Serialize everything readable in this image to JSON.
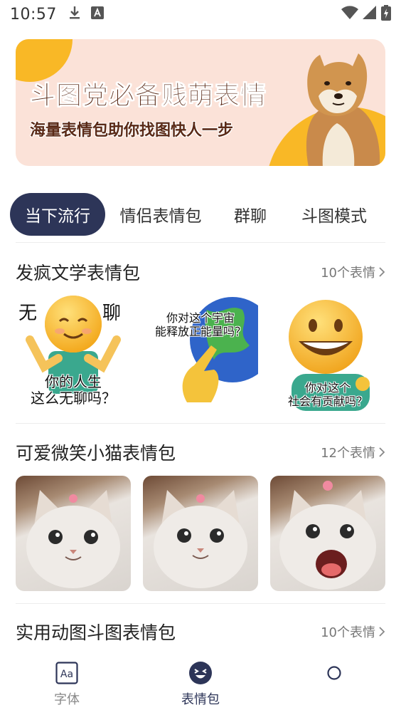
{
  "status_bar": {
    "time": "10:57",
    "icons": [
      "download-icon",
      "text-a-icon",
      "wifi-icon",
      "signal-icon",
      "battery-charging-icon"
    ]
  },
  "banner": {
    "title": "斗图党必备贱萌表情",
    "subtitle": "海量表情包助你找图快人一步",
    "accent_color": "#f9b826",
    "background_color": "#fbe2d8",
    "text_color": "#5a2a17"
  },
  "tabs": [
    {
      "label": "当下流行",
      "active": true
    },
    {
      "label": "情侣表情包",
      "active": false
    },
    {
      "label": "群聊",
      "active": false
    },
    {
      "label": "斗图模式",
      "active": false
    }
  ],
  "sections": [
    {
      "title": "发疯文学表情包",
      "count_label": "10个表情",
      "stickers": [
        {
          "name": "bored-life-sticker",
          "caption": "你的人生\n这么无聊吗？",
          "top_left": "无",
          "top_right": "聊"
        },
        {
          "name": "universe-energy-sticker",
          "caption": "你对这个宇宙\n能释放正能量吗？"
        },
        {
          "name": "society-contribution-sticker",
          "caption": "你对这个\n社会有贡献吗？"
        }
      ]
    },
    {
      "title": "可爱微笑小猫表情包",
      "count_label": "12个表情",
      "stickers": [
        {
          "name": "smiling-cat-1"
        },
        {
          "name": "smiling-cat-2"
        },
        {
          "name": "smiling-cat-3"
        }
      ]
    },
    {
      "title": "实用动图斗图表情包",
      "count_label": "10个表情"
    }
  ],
  "bottom_nav": [
    {
      "label": "字体",
      "icon": "font-aa-icon",
      "active": false
    },
    {
      "label": "表情包",
      "icon": "emoji-face-icon",
      "active": true
    },
    {
      "label": "",
      "icon": "circle-icon",
      "active": false
    }
  ],
  "colors": {
    "primary": "#2d3558",
    "muted_text": "#777777"
  }
}
